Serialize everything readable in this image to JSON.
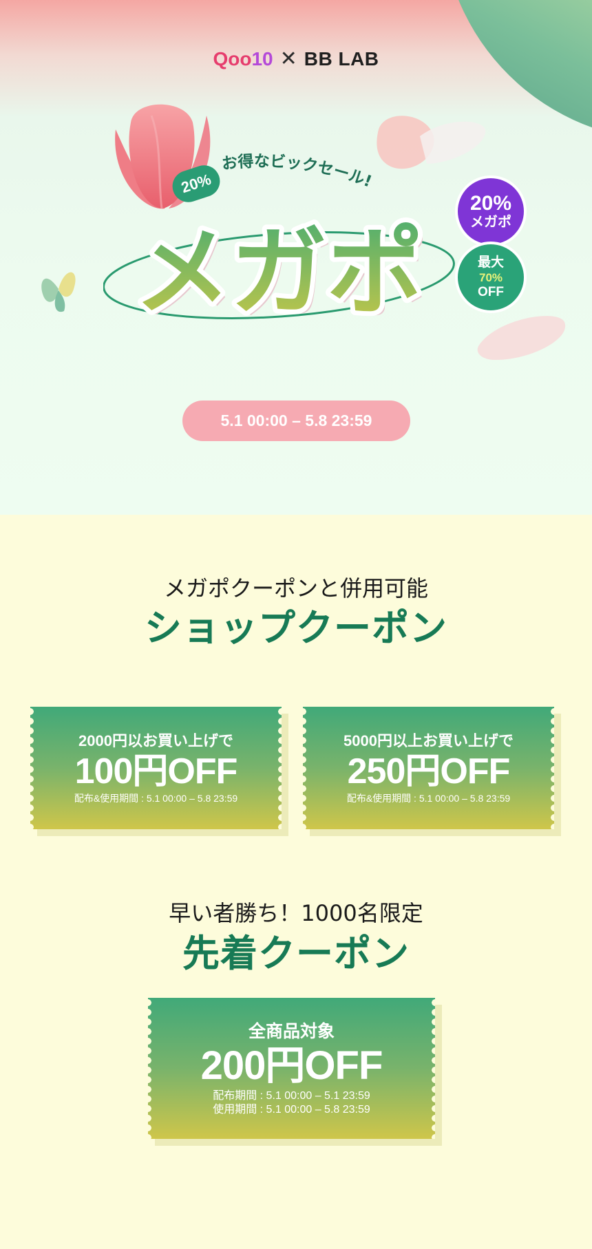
{
  "brand": {
    "qoo_main": "Qoo",
    "qoo_num": "10",
    "cross": "✕",
    "partner": "BB LAB"
  },
  "hero": {
    "pill_percent": "20%",
    "subtitle": "お得なビックセール!",
    "title": "メガポ",
    "badge_purple": {
      "line1": "20%",
      "line2": "メガポ"
    },
    "badge_green": {
      "line1": "最大",
      "line2": "70%",
      "line3": "OFF"
    },
    "period": "5.1 00:00 – 5.8 23:59"
  },
  "shop_coupon": {
    "subtitle": "メガポクーポンと併用可能",
    "title": "ショップクーポン",
    "coupons": [
      {
        "condition": "2000円以お買い上げで",
        "amount": "100円OFF",
        "period": "配布&使用期間 : 5.1 00:00 – 5.8 23:59"
      },
      {
        "condition": "5000円以上お買い上げで",
        "amount": "250円OFF",
        "period": "配布&使用期間 : 5.1 00:00 – 5.8 23:59"
      }
    ]
  },
  "early_coupon": {
    "subtitle": "早い者勝ち！1000名限定",
    "title": "先着クーポン",
    "coupon": {
      "condition": "全商品対象",
      "amount": "200円OFF",
      "distribution": "配布期間 : 5.1 00:00 – 5.1 23:59",
      "usage": "使用期間 : 5.1 00:00 – 5.8 23:59"
    }
  }
}
